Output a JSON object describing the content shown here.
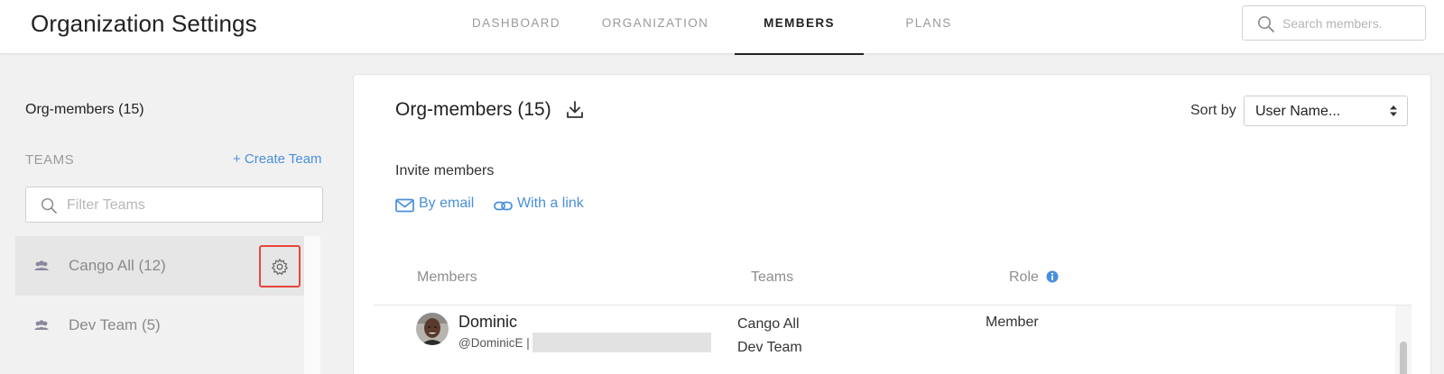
{
  "header": {
    "title": "Organization Settings",
    "tabs": [
      {
        "label": "DASHBOARD",
        "active": false
      },
      {
        "label": "ORGANIZATION",
        "active": false
      },
      {
        "label": "MEMBERS",
        "active": true
      },
      {
        "label": "PLANS",
        "active": false
      }
    ],
    "search_placeholder": "Search members."
  },
  "sidebar": {
    "title": "Org-members (15)",
    "teams_label": "TEAMS",
    "create_team": "+ Create Team",
    "filter_placeholder": "Filter Teams",
    "teams": [
      {
        "name": "Cango All (12)",
        "selected": true
      },
      {
        "name": "Dev Team (5)",
        "selected": false
      }
    ]
  },
  "main": {
    "title": "Org-members (15)",
    "sort_label": "Sort by",
    "sort_value": "User Name...",
    "invite_label": "Invite members",
    "invite_email": "By email",
    "invite_link": "With a link",
    "columns": {
      "members": "Members",
      "teams": "Teams",
      "role": "Role"
    },
    "rows": [
      {
        "name": "Dominic",
        "handle": "@DominicE |",
        "teams": [
          "Cango All",
          "Dev Team"
        ],
        "role": "Member"
      }
    ]
  },
  "colors": {
    "accent": "#4a90d9",
    "highlight_border": "#e8453c",
    "selected_bg": "#e6e6e6"
  },
  "icons": [
    "search-icon",
    "users-icon",
    "gear-icon",
    "download-icon",
    "envelope-icon",
    "link-icon",
    "info-icon",
    "sort-arrows-icon"
  ]
}
